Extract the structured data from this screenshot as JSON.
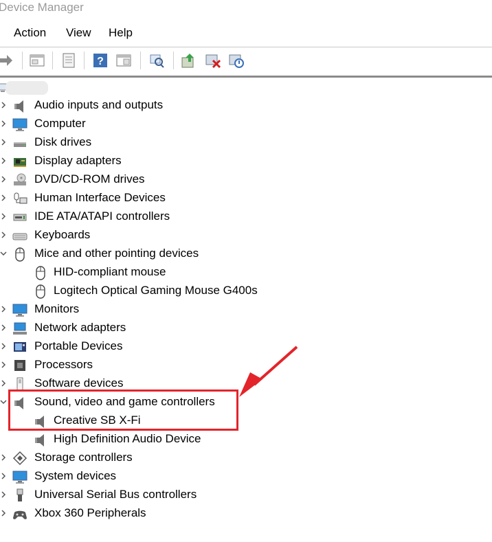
{
  "window": {
    "title": "Device Manager"
  },
  "menu": {
    "items": [
      "Action",
      "View",
      "Help"
    ]
  },
  "toolbar": {
    "buttons": [
      "back-icon",
      "properties-icon",
      "details-icon",
      "help-icon",
      "view-icon",
      "scan-hardware-icon",
      "update-driver-icon",
      "uninstall-icon",
      "enable-icon"
    ]
  },
  "tree": {
    "categories": [
      {
        "label": "Audio inputs and outputs",
        "icon": "speaker-icon",
        "expanded": false
      },
      {
        "label": "Computer",
        "icon": "monitor-icon",
        "expanded": false
      },
      {
        "label": "Disk drives",
        "icon": "disk-icon",
        "expanded": false
      },
      {
        "label": "Display adapters",
        "icon": "display-adapter-icon",
        "expanded": false
      },
      {
        "label": "DVD/CD-ROM drives",
        "icon": "dvd-icon",
        "expanded": false
      },
      {
        "label": "Human Interface Devices",
        "icon": "hid-icon",
        "expanded": false
      },
      {
        "label": "IDE ATA/ATAPI controllers",
        "icon": "ide-icon",
        "expanded": false
      },
      {
        "label": "Keyboards",
        "icon": "keyboard-icon",
        "expanded": false
      },
      {
        "label": "Mice and other pointing devices",
        "icon": "mouse-icon",
        "expanded": true,
        "children": [
          {
            "label": "HID-compliant mouse",
            "icon": "mouse-icon"
          },
          {
            "label": "Logitech Optical Gaming Mouse G400s",
            "icon": "mouse-icon"
          }
        ]
      },
      {
        "label": "Monitors",
        "icon": "monitor-icon",
        "expanded": false
      },
      {
        "label": "Network adapters",
        "icon": "network-icon",
        "expanded": false
      },
      {
        "label": "Portable Devices",
        "icon": "portable-icon",
        "expanded": false
      },
      {
        "label": "Processors",
        "icon": "processor-icon",
        "expanded": false
      },
      {
        "label": "Software devices",
        "icon": "software-icon",
        "expanded": false
      },
      {
        "label": "Sound, video and game controllers",
        "icon": "speaker-icon",
        "expanded": true,
        "children": [
          {
            "label": "Creative SB X-Fi",
            "icon": "speaker-icon"
          },
          {
            "label": "High Definition Audio Device",
            "icon": "speaker-icon"
          }
        ]
      },
      {
        "label": "Storage controllers",
        "icon": "storage-icon",
        "expanded": false
      },
      {
        "label": "System devices",
        "icon": "monitor-icon",
        "expanded": false
      },
      {
        "label": "Universal Serial Bus controllers",
        "icon": "usb-icon",
        "expanded": false
      },
      {
        "label": "Xbox 360 Peripherals",
        "icon": "gamepad-icon",
        "expanded": false
      }
    ]
  },
  "annotation": {
    "color": "#e3242b"
  }
}
